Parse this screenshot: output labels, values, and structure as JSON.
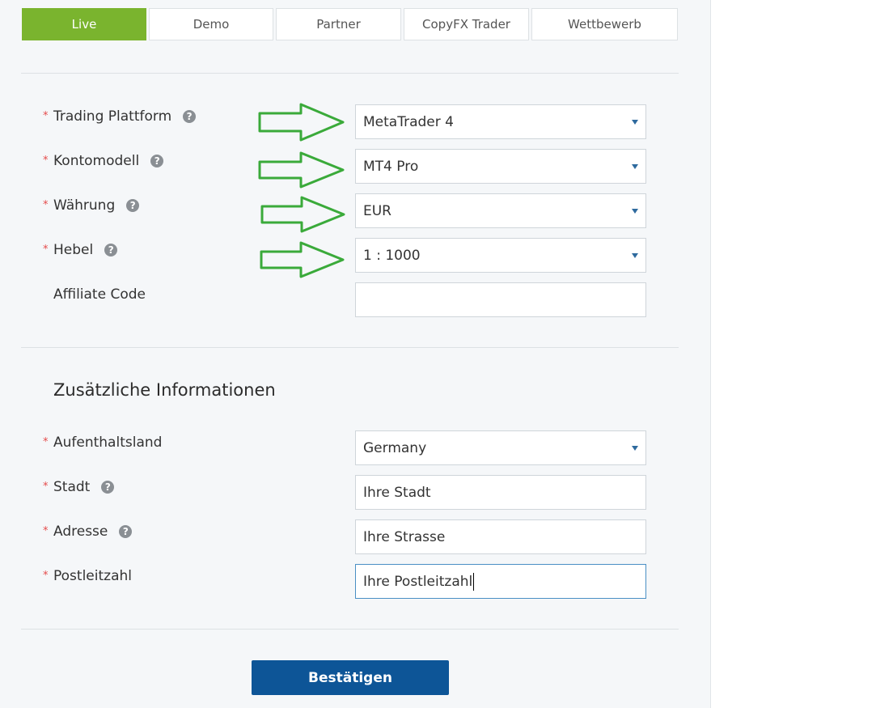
{
  "tabs": [
    {
      "label": "Live",
      "active": true
    },
    {
      "label": "Demo",
      "active": false
    },
    {
      "label": "Partner",
      "active": false
    },
    {
      "label": "CopyFX Trader",
      "active": false
    },
    {
      "label": "Wettbewerb",
      "active": false
    }
  ],
  "account": {
    "platform": {
      "label": "Trading Plattform",
      "value": "MetaTrader 4"
    },
    "model": {
      "label": "Kontomodell",
      "value": "MT4 Pro"
    },
    "currency": {
      "label": "Währung",
      "value": "EUR"
    },
    "leverage": {
      "label": "Hebel",
      "value": "1 : 1000"
    },
    "affiliate": {
      "label": "Affiliate Code",
      "value": ""
    }
  },
  "additional": {
    "title": "Zusätzliche Informationen",
    "country": {
      "label": "Aufenthaltsland",
      "value": "Germany"
    },
    "city": {
      "label": "Stadt",
      "value": "Ihre Stadt"
    },
    "address": {
      "label": "Adresse",
      "value": "Ihre Strasse"
    },
    "postcode": {
      "label": "Postleitzahl",
      "value": "Ihre Postleitzahl"
    }
  },
  "required_marker": "*",
  "help_glyph": "?",
  "submit_label": "Bestätigen",
  "colors": {
    "active_tab": "#7ab42e",
    "submit": "#0d5597",
    "required": "#e54b4b",
    "annotation_arrow": "#3aaa3a"
  }
}
